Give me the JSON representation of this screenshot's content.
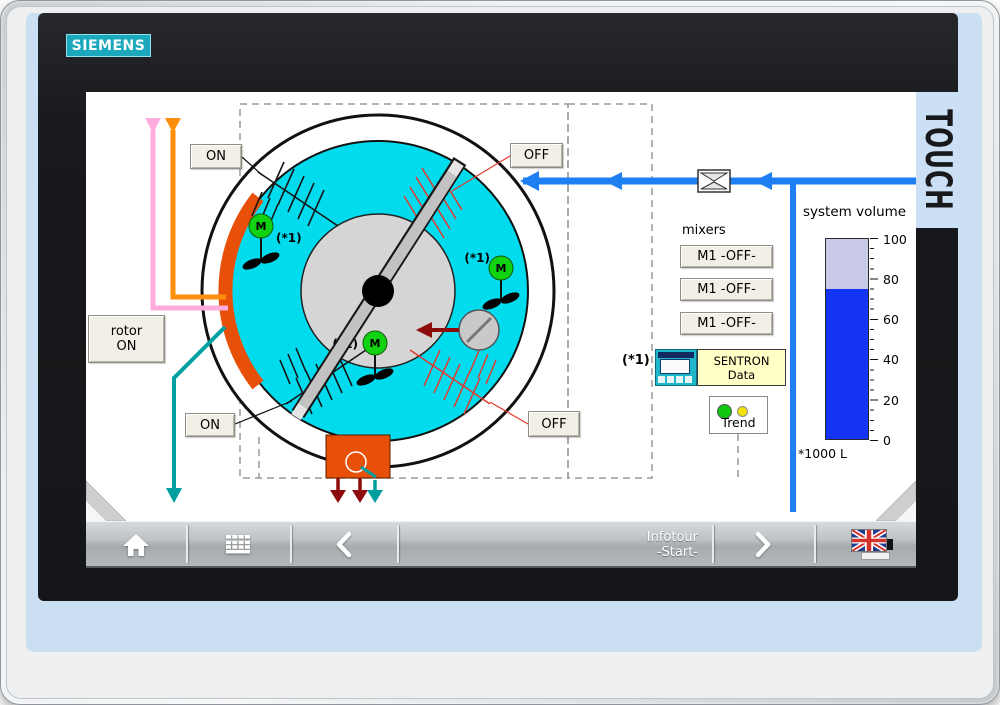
{
  "device": {
    "brand_logo": "SIEMENS",
    "touch_badge": "TOUCH"
  },
  "screen": {
    "tank": {
      "on_top": "ON",
      "off_top": "OFF",
      "on_bottom": "ON",
      "off_bottom": "OFF",
      "rotor_line1": "rotor",
      "rotor_line2": "ON",
      "motor_label": "M",
      "footnote": "(*1)"
    },
    "mixers": {
      "title": "mixers",
      "buttons": [
        "M1 -OFF-",
        "M1 -OFF-",
        "M1 -OFF-"
      ]
    },
    "sentron": {
      "footnote": "(*1)",
      "line1": "SENTRON",
      "line2": "Data"
    },
    "trend_label": "Trend",
    "gauge": {
      "title": "system volume",
      "unit": "*1000 L",
      "tick_labels": [
        "100",
        "80",
        "60",
        "40",
        "20",
        "0"
      ],
      "value_percent": 75
    }
  },
  "navbar": {
    "infotour_line1": "Infotour",
    "infotour_line2": "-Start-",
    "icons": [
      "home-icon",
      "menu-grid-icon",
      "back-icon",
      "forward-icon",
      "language-flag-icon"
    ]
  },
  "colors": {
    "tank_water": "#00DBEE",
    "alarm_orange": "#E8500A",
    "pipe_orange": "#FF8E0D",
    "pipe_pink": "#FFABDE",
    "pipe_teal": "#009F9F",
    "pipe_blue": "#1E7FF2",
    "arrow_dark_red": "#8E0B0B",
    "motor_green": "#12D312",
    "gauge_blue": "#1333F5",
    "gauge_rest": "#C9C9E8"
  }
}
